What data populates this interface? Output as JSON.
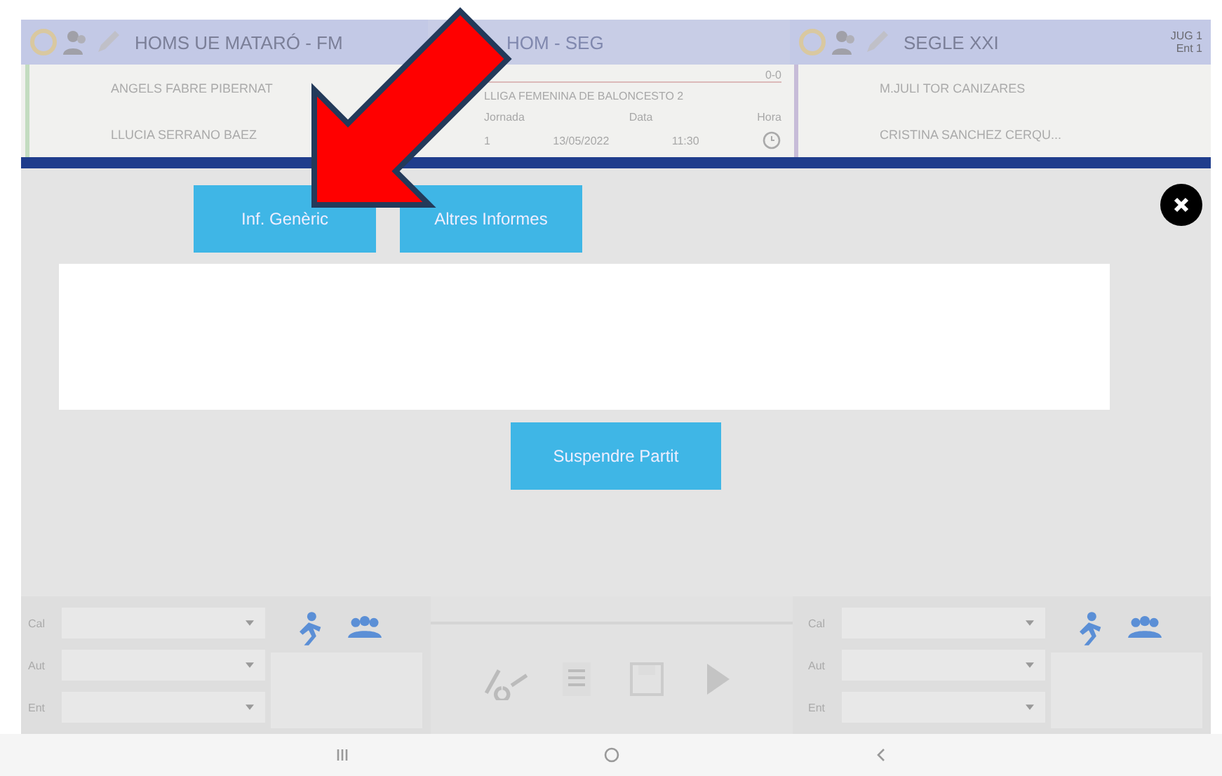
{
  "header": {
    "home": {
      "name": "HOMS UE MATARÓ - FM",
      "players": [
        "ANGELS FABRE PIBERNAT",
        "LLUCIA SERRANO BAEZ"
      ]
    },
    "match": {
      "title": "HOM - SEG",
      "score": "0-0",
      "competition": "LLIGA FEMENINA DE BALONCESTO 2",
      "labels": [
        "Jornada",
        "Data",
        "Hora"
      ],
      "round": "1",
      "date": "13/05/2022",
      "time": "11:30"
    },
    "away": {
      "name": "SEGLE XXI",
      "players": [
        "M.JULI TOR CANIZARES",
        "CRISTINA SANCHEZ CERQU..."
      ],
      "badges": [
        "JUG 1",
        "Ent 1"
      ]
    }
  },
  "modal": {
    "tabs": [
      "Inf. Genèric",
      "Altres Informes"
    ],
    "action": "Suspendre Partit"
  },
  "bottom": {
    "home_fields": [
      "Cal",
      "Aut",
      "Ent"
    ],
    "away_fields": [
      "Cal",
      "Aut",
      "Ent"
    ]
  }
}
